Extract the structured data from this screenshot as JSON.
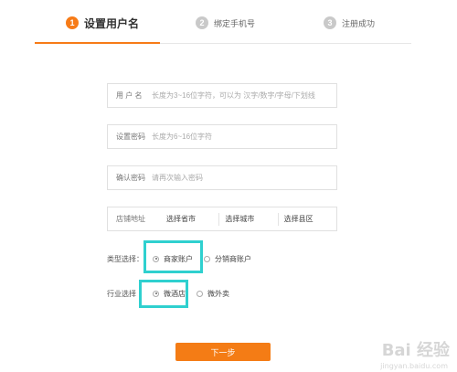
{
  "steps": [
    {
      "num": "1",
      "label": "设置用户名"
    },
    {
      "num": "2",
      "label": "绑定手机号"
    },
    {
      "num": "3",
      "label": "注册成功"
    }
  ],
  "form": {
    "username": {
      "label": "用 户 名",
      "placeholder": "长度为3~16位字符，可以为 汉字/数字/字母/下划线"
    },
    "password": {
      "label": "设置密码",
      "placeholder": "长度为6~16位字符"
    },
    "confirm": {
      "label": "确认密码",
      "placeholder": "请再次输入密码"
    },
    "address": {
      "label": "店铺地址",
      "province": "选择省市",
      "city": "选择城市",
      "county": "选择县区"
    }
  },
  "account_type": {
    "label": "类型选择：",
    "options": [
      "商家账户",
      "分销商账户"
    ],
    "selected": "商家账户"
  },
  "industry": {
    "label": "行业选择",
    "options": [
      "微酒店",
      "微外卖"
    ],
    "selected": "微酒店"
  },
  "next_label": "下一步",
  "watermark": {
    "main": "Bai 经验",
    "sub": "jingyan.baidu.com"
  },
  "colors": {
    "accent": "#f77b17",
    "highlight": "#2fd0cf"
  }
}
